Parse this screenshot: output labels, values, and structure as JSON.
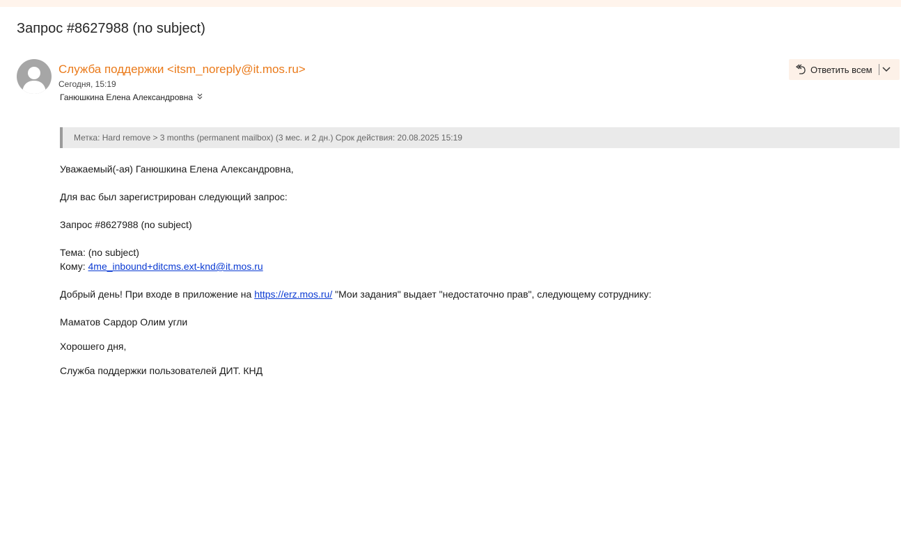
{
  "email": {
    "subject": "Запрос #8627988 (no subject)",
    "sender": "Служба поддержки <itsm_noreply@it.mos.ru>",
    "date": "Сегодня, 15:19",
    "recipient": "Ганюшкина Елена Александровна",
    "reply_all_label": "Ответить всем",
    "retention_label": "Метка: Hard remove > 3 months (permanent mailbox) (3 мес. и 2 дн.) Срок действия: 20.08.2025 15:19"
  },
  "body": {
    "greeting": "Уважаемый(-ая) Ганюшкина Елена Александровна,",
    "registered": "Для вас был зарегистрирован следующий запрос:",
    "request": "Запрос #8627988 (no subject)",
    "topic": "Тема: (no subject)",
    "to_prefix": "Кому: ",
    "to_address": "4me_inbound+ditcms.ext-knd@it.mos.ru",
    "message_prefix": "Добрый день! При входе в приложение на ",
    "message_link": "https://erz.mos.ru/",
    "message_suffix": " \"Мои задания\" выдает \"недостаточно прав\", следующему сотруднику:",
    "employee": "Маматов Сардор Олим угли",
    "closing": "Хорошего дня,",
    "signature": "Служба поддержки пользователей ДИТ. КНД"
  },
  "icons": {
    "avatar": "person-icon",
    "reply_all": "reply-all-icon",
    "dropdown": "chevron-down-icon",
    "recipient_expand": "double-chevron-down-icon"
  },
  "colors": {
    "sender": "#ea7a1a",
    "link": "#0b3bd3",
    "label_bar": "#eaeaea",
    "reply_button_bg": "#fdf1e8"
  }
}
